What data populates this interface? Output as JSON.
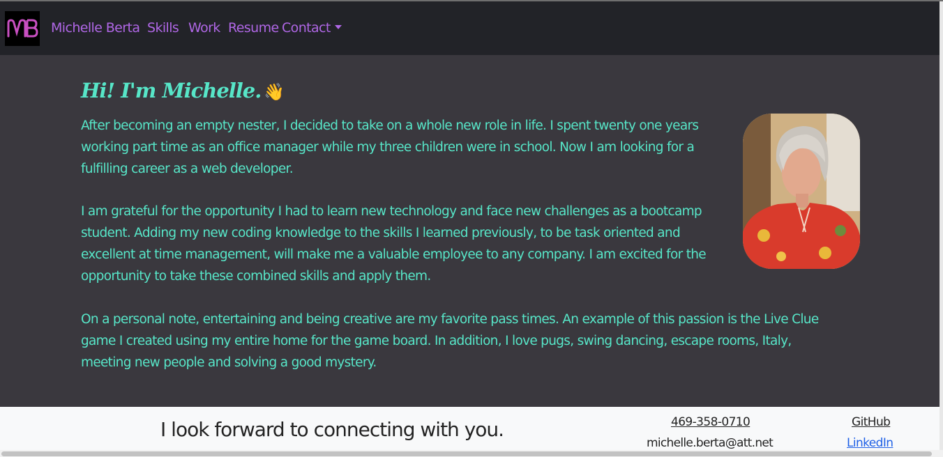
{
  "navbar": {
    "logo_text": "MB",
    "brand": "Michelle Berta",
    "links": [
      "Skills",
      "Work",
      "Resume",
      "Contact"
    ],
    "colors": {
      "link": "#b067e6",
      "background": "#222328"
    }
  },
  "about": {
    "greeting": "Hi! I'm Michelle.",
    "greeting_emoji": "👋",
    "paragraphs": [
      "After becoming an empty nester, I decided to take on a whole new role in life. I spent twenty one years working part time as an office manager while my three children were in school. Now I am looking for a fulfilling career as a web developer.",
      "I am grateful for the opportunity I had to learn new technology and face new challenges as a bootcamp student. Adding my new coding knowledge to the skills I learned previously, to be task oriented and excellent at time management, will make me a valuable employee to any company. I am excited for the opportunity to take these combined skills and apply them.",
      "On a personal note, entertaining and being creative are my favorite pass times. An example of this passion is the Live Clue game I created using my entire home for the game board. In addition, I love pugs, swing dancing, escape rooms, Italy, meeting new people and solving a good mystery."
    ],
    "colors": {
      "text": "#57e6c8",
      "background": "#3a383e"
    }
  },
  "footer": {
    "message": "I look forward to connecting with you.",
    "phone": "469-358-0710",
    "email": "michelle.berta@att.net",
    "github": "GitHub",
    "linkedin": "LinkedIn"
  }
}
